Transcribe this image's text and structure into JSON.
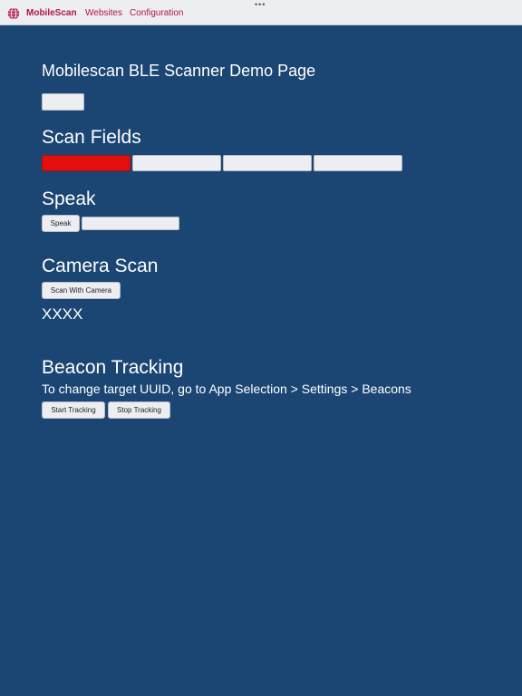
{
  "topbar": {
    "brand": "MobileScan",
    "links": [
      "Websites",
      "Configuration"
    ],
    "dots": "•••",
    "icon": "globe-icon"
  },
  "page": {
    "title": "Mobilescan BLE Scanner Demo Page",
    "scan_fields_heading": "Scan Fields",
    "speak_heading": "Speak",
    "speak_button": "Speak",
    "camera_heading": "Camera Scan",
    "camera_button": "Scan With Camera",
    "camera_result": "XXXX",
    "beacon_heading": "Beacon Tracking",
    "beacon_instructions": "To change target UUID, go to App Selection > Settings > Beacons",
    "start_tracking_button": "Start Tracking",
    "stop_tracking_button": "Stop Tracking"
  },
  "colors": {
    "background": "#1b4674",
    "brand": "#b5124a",
    "active_field": "#e30f0f"
  }
}
